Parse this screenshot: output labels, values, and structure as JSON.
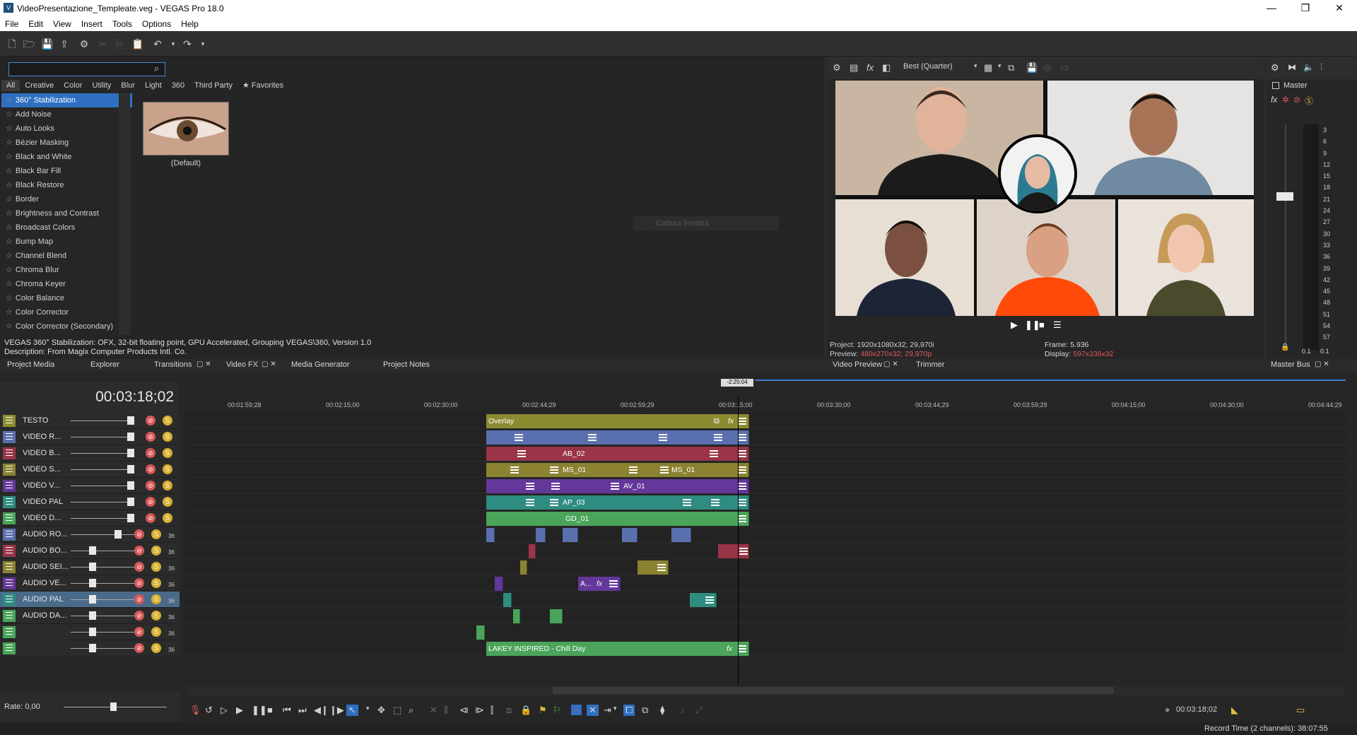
{
  "window": {
    "title": "VideoPresentazione_Templeate.veg - VEGAS Pro 18.0",
    "minimize": "—",
    "maximize": "❐",
    "close": "✕"
  },
  "menu": [
    "File",
    "Edit",
    "View",
    "Insert",
    "Tools",
    "Options",
    "Help"
  ],
  "fx": {
    "search_value": "",
    "tabs": [
      "All",
      "Creative",
      "Color",
      "Utility",
      "Blur",
      "Light",
      "360",
      "Third Party",
      "★ Favorites"
    ],
    "items": [
      "360° Stabilization",
      "Add Noise",
      "Auto Looks",
      "Bézier Masking",
      "Black and White",
      "Black Bar Fill",
      "Black Restore",
      "Border",
      "Brightness and Contrast",
      "Broadcast Colors",
      "Bump Map",
      "Channel Blend",
      "Chroma Blur",
      "Chroma Keyer",
      "Color Balance",
      "Color Corrector",
      "Color Corrector (Secondary)"
    ],
    "preset_label": "(Default)",
    "capture_label": "Cattura finestra",
    "info_line1": "VEGAS 360° Stabilization: OFX, 32-bit floating point, GPU Accelerated, Grouping VEGAS\\360, Version 1.0",
    "info_line2": "Description: From Magix Computer Products Intl. Co."
  },
  "preview": {
    "quality": "Best (Quarter)",
    "project_label": "Project:",
    "project_value": "1920x1080x32; 29,970i",
    "preview_label": "Preview:",
    "preview_value": "480x270x32; 29,970p",
    "frame_label": "Frame:",
    "frame_value": "5.936",
    "display_label": "Display:",
    "display_value": "597x336x32"
  },
  "master": {
    "label": "Master",
    "scale": [
      "3",
      "6",
      "9",
      "12",
      "15",
      "18",
      "21",
      "24",
      "27",
      "30",
      "33",
      "36",
      "39",
      "42",
      "45",
      "48",
      "51",
      "54",
      "57"
    ],
    "left_value": "0.1",
    "right_value": "0.1"
  },
  "dock_tabs": [
    "Project Media",
    "Explorer",
    "Transitions",
    "Video FX",
    "Media Generator",
    "Project Notes"
  ],
  "dock_tabs_right": [
    "Video Preview",
    "Trimmer"
  ],
  "dock_master": "Master Bus",
  "timeline": {
    "timecode": "00:03:18;02",
    "cursor_flag": "-2:25:04",
    "ruler": [
      "00:01:59;28",
      "00:02:15;00",
      "00:02:30;00",
      "00:02:44;29",
      "00:02:59;29",
      "00:03:15;00",
      "00:03:30;00",
      "00:03:44;29",
      "00:03:59;29",
      "00:04:15;00",
      "00:04:30;00",
      "00:04:44;29"
    ],
    "tracks": [
      {
        "name": "TESTO",
        "color": "#8d8b32",
        "type": "video"
      },
      {
        "name": "VIDEO R...",
        "color": "#5a6fad",
        "type": "video"
      },
      {
        "name": "VIDEO B...",
        "color": "#9a3447",
        "type": "video"
      },
      {
        "name": "VIDEO S...",
        "color": "#8b8331",
        "type": "video"
      },
      {
        "name": "VIDEO V...",
        "color": "#64379a",
        "type": "video"
      },
      {
        "name": "VIDEO PAL",
        "color": "#2e8c80",
        "type": "video"
      },
      {
        "name": "VIDEO D...",
        "color": "#4aa55a",
        "type": "video"
      },
      {
        "name": "AUDIO RO...",
        "color": "#5a6fad",
        "type": "audio",
        "num": "36"
      },
      {
        "name": "AUDIO BO...",
        "color": "#9a3447",
        "type": "audio",
        "num": "36"
      },
      {
        "name": "AUDIO SEI...",
        "color": "#8b8331",
        "type": "audio",
        "num": "36"
      },
      {
        "name": "AUDIO VE...",
        "color": "#64379a",
        "type": "audio",
        "num": "36"
      },
      {
        "name": "AUDIO PAL",
        "color": "#2e8c80",
        "type": "audio",
        "num": "36"
      },
      {
        "name": "AUDIO DA...",
        "color": "#4aa55a",
        "type": "audio",
        "num": "36"
      },
      {
        "name": "",
        "color": "#4aa55a",
        "type": "audio",
        "num": "36"
      },
      {
        "name": "",
        "color": "#4aa55a",
        "type": "audio",
        "num": "36"
      }
    ],
    "clip_labels": {
      "overlay": "Overlay",
      "ab": "AB_02",
      "ms1": "MS_01",
      "ms2": "MS_01",
      "av": "AV_01",
      "ap": "AP_03",
      "gd": "GD_01",
      "aud": "A...",
      "music": "LAKEY INSPIRED - Chill Day"
    }
  },
  "transport": {
    "rate": "Rate: 0,00",
    "cursor_time": "00:03:18;02",
    "record_time": "Record Time (2 channels): 38:07:55"
  }
}
